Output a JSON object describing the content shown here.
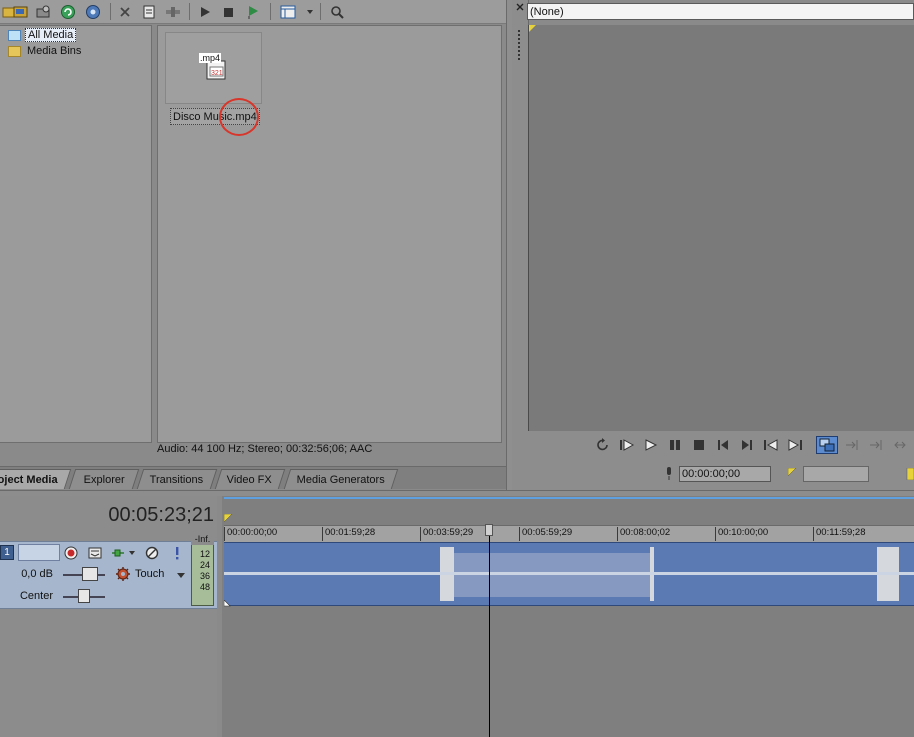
{
  "explorer": {
    "tree_items": [
      "All Media",
      "Media Bins"
    ],
    "media_file": "Disco Music.mp4",
    "file_badge": ".mp4",
    "status": "Audio: 44 100 Hz; Stereo; 00:32:56;06; AAC"
  },
  "tabs": [
    "oject Media",
    "Explorer",
    "Transitions",
    "Video FX",
    "Media Generators"
  ],
  "preview": {
    "dropdown_value": "(None)",
    "timecode": "00:00:00;00"
  },
  "timeline": {
    "cursor_time": "00:05:23;21",
    "track_number": "1",
    "volume": "0,0 dB",
    "pan": "Center",
    "automation_mode": "Touch",
    "meter_labels": [
      "-Inf.",
      "12",
      "24",
      "36",
      "48"
    ],
    "ruler_labels": [
      "00:00:00;00",
      "00:01:59;28",
      "00:03:59;29",
      "00:05:59;29",
      "00:08:00;02",
      "00:10:00;00",
      "00:11:59;28"
    ]
  },
  "colors": {
    "highlight_circle": "#d9352a",
    "clip": "#5b79b3",
    "timeline_accent": "#5fa0e0"
  }
}
